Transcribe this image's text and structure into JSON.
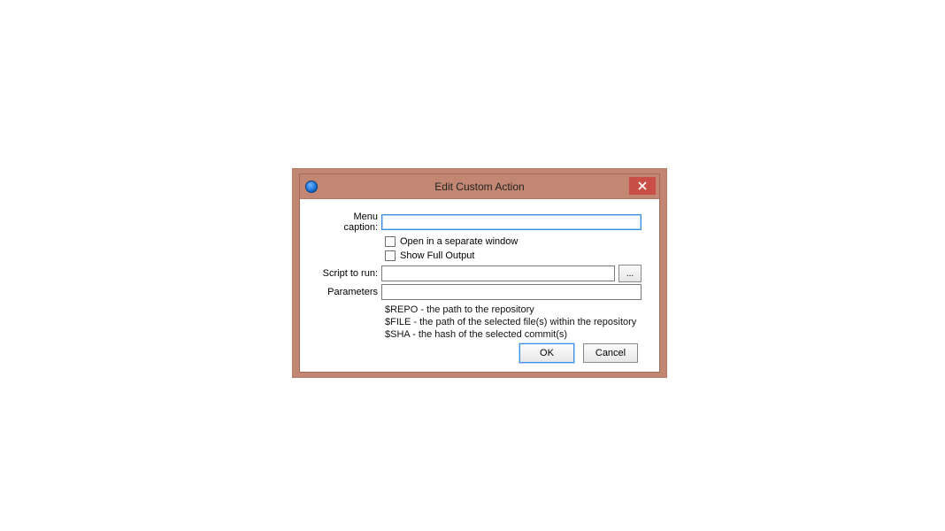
{
  "window": {
    "title": "Edit Custom Action",
    "close_glyph": "×"
  },
  "form": {
    "menu_caption": {
      "label": "Menu caption:",
      "value": ""
    },
    "open_separate": {
      "label": "Open in a separate window",
      "checked": false
    },
    "show_full_output": {
      "label": "Show Full Output",
      "checked": false
    },
    "script_to_run": {
      "label": "Script to run:",
      "value": "",
      "browse_label": "..."
    },
    "parameters": {
      "label": "Parameters",
      "value": ""
    },
    "helper": {
      "line1": "$REPO - the path to the repository",
      "line2": "$FILE - the path of the selected file(s) within the repository",
      "line3": "$SHA - the hash of the selected commit(s)"
    }
  },
  "buttons": {
    "ok": "OK",
    "cancel": "Cancel"
  }
}
